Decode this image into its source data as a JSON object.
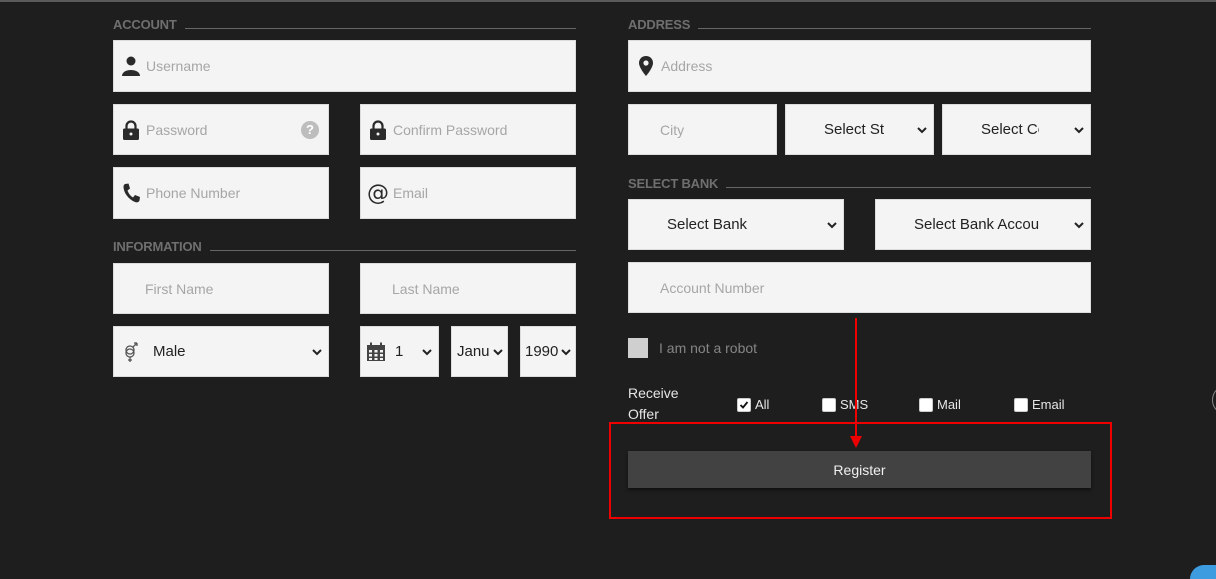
{
  "sections": {
    "account": "ACCOUNT",
    "information": "INFORMATION",
    "address": "ADDRESS",
    "select_bank": "SELECT BANK"
  },
  "account": {
    "username_placeholder": "Username",
    "password_placeholder": "Password",
    "confirm_password_placeholder": "Confirm Password",
    "phone_placeholder": "Phone Number",
    "email_placeholder": "Email",
    "help_glyph": "?"
  },
  "information": {
    "first_name_placeholder": "First Name",
    "last_name_placeholder": "Last Name",
    "gender": "Male",
    "day": "1",
    "month": "Janu",
    "year": "1990"
  },
  "address": {
    "address_placeholder": "Address",
    "city_placeholder": "City",
    "state": "Select St",
    "country": "Select Co"
  },
  "bank": {
    "bank": "Select Bank",
    "bank_account": "Select Bank Accou",
    "account_number_placeholder": "Account Number"
  },
  "captcha": {
    "label": "I am not a robot"
  },
  "offer": {
    "label": "Receive Offer",
    "options": [
      {
        "label": "All",
        "checked": true
      },
      {
        "label": "SMS",
        "checked": false
      },
      {
        "label": "Mail",
        "checked": false
      },
      {
        "label": "Email",
        "checked": false
      }
    ]
  },
  "register_label": "Register",
  "colors": {
    "background": "#1e1e1e",
    "field": "#f4f4f4",
    "button": "#424242",
    "annotation": "#ee0000"
  }
}
